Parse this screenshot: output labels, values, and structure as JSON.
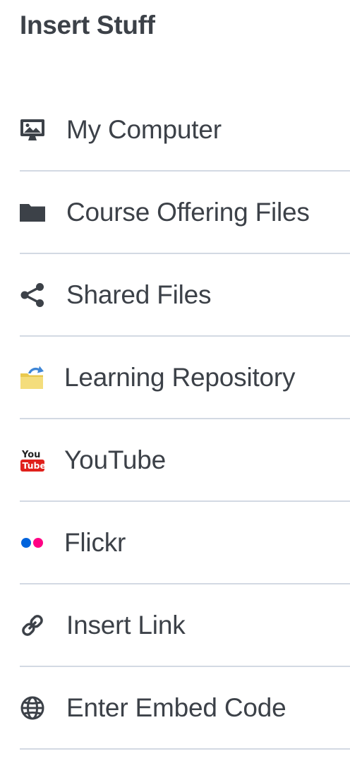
{
  "panel": {
    "title": "Insert Stuff"
  },
  "menu": {
    "items": [
      {
        "label": "My Computer",
        "icon": "monitor-image-icon"
      },
      {
        "label": "Course Offering Files",
        "icon": "folder-icon"
      },
      {
        "label": "Shared Files",
        "icon": "share-icon"
      },
      {
        "label": "Learning Repository",
        "icon": "repository-folder-icon"
      },
      {
        "label": "YouTube",
        "icon": "youtube-icon"
      },
      {
        "label": "Flickr",
        "icon": "flickr-icon"
      },
      {
        "label": "Insert Link",
        "icon": "link-icon"
      },
      {
        "label": "Enter Embed Code",
        "icon": "globe-icon"
      }
    ]
  },
  "colors": {
    "text": "#3c4148",
    "divider": "#d3d9e3",
    "youtube_red": "#e0201b",
    "flickr_blue": "#0063dc",
    "flickr_pink": "#ff0084",
    "repo_folder": "#f2da74",
    "repo_arrow": "#3f86d6"
  }
}
